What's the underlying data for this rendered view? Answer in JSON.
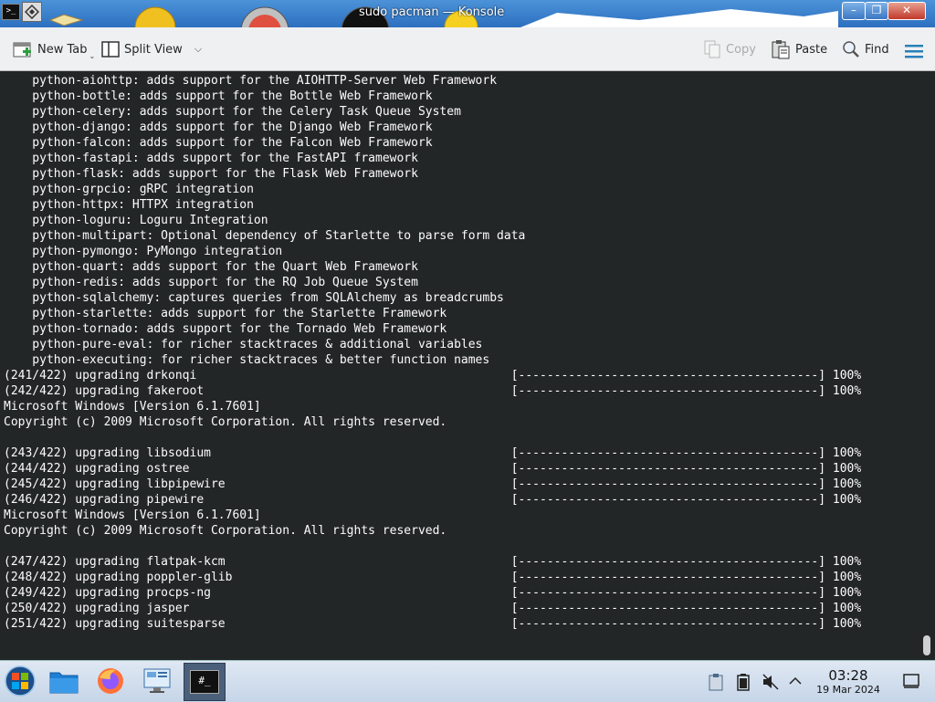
{
  "window": {
    "title": "sudo pacman — Konsole",
    "app_icon_text": ">_"
  },
  "toolbar": {
    "new_tab_label": "New Tab",
    "split_view_label": "Split View",
    "copy_label": "Copy",
    "paste_label": "Paste",
    "find_label": "Find"
  },
  "terminal": {
    "lines": [
      "    python-aiohttp: adds support for the AIOHTTP-Server Web Framework",
      "    python-bottle: adds support for the Bottle Web Framework",
      "    python-celery: adds support for the Celery Task Queue System",
      "    python-django: adds support for the Django Web Framework",
      "    python-falcon: adds support for the Falcon Web Framework",
      "    python-fastapi: adds support for the FastAPI framework",
      "    python-flask: adds support for the Flask Web Framework",
      "    python-grpcio: gRPC integration",
      "    python-httpx: HTTPX integration",
      "    python-loguru: Loguru Integration",
      "    python-multipart: Optional dependency of Starlette to parse form data",
      "    python-pymongo: PyMongo integration",
      "    python-quart: adds support for the Quart Web Framework",
      "    python-redis: adds support for the RQ Job Queue System",
      "    python-sqlalchemy: captures queries from SQLAlchemy as breadcrumbs",
      "    python-starlette: adds support for the Starlette Framework",
      "    python-tornado: adds support for the Tornado Web Framework",
      "    python-pure-eval: for richer stacktraces & additional variables",
      "    python-executing: for richer stacktraces & better function names",
      "(241/422) upgrading drkonqi                                            [------------------------------------------] 100%",
      "(242/422) upgrading fakeroot                                           [------------------------------------------] 100%",
      "Microsoft Windows [Version 6.1.7601]",
      "Copyright (c) 2009 Microsoft Corporation. All rights reserved.",
      "",
      "(243/422) upgrading libsodium                                          [------------------------------------------] 100%",
      "(244/422) upgrading ostree                                             [------------------------------------------] 100%",
      "(245/422) upgrading libpipewire                                        [------------------------------------------] 100%",
      "(246/422) upgrading pipewire                                           [------------------------------------------] 100%",
      "Microsoft Windows [Version 6.1.7601]",
      "Copyright (c) 2009 Microsoft Corporation. All rights reserved.",
      "",
      "(247/422) upgrading flatpak-kcm                                        [------------------------------------------] 100%",
      "(248/422) upgrading poppler-glib                                       [------------------------------------------] 100%",
      "(249/422) upgrading procps-ng                                          [------------------------------------------] 100%",
      "(250/422) upgrading jasper                                             [------------------------------------------] 100%",
      "(251/422) upgrading suitesparse                                        [------------------------------------------] 100%"
    ]
  },
  "taskbar": {
    "clock_time": "03:28",
    "clock_date": "19 Mar 2024",
    "konsole_icon_text": "#_"
  }
}
